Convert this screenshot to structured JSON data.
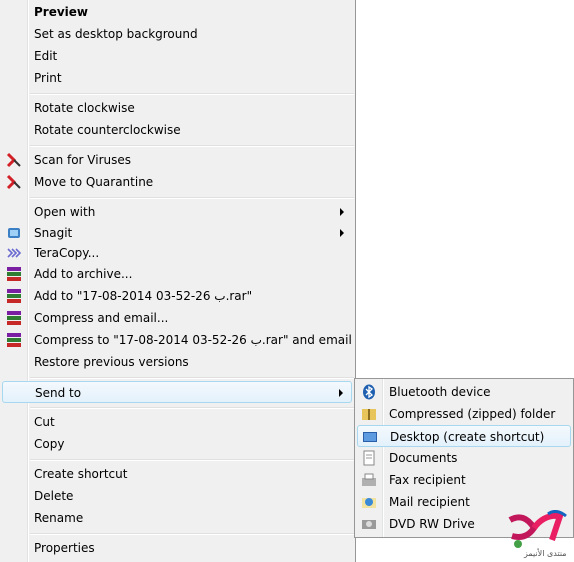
{
  "menu": {
    "preview": "Preview",
    "set_desktop_bg": "Set as desktop background",
    "edit": "Edit",
    "print": "Print",
    "rotate_cw": "Rotate clockwise",
    "rotate_ccw": "Rotate counterclockwise",
    "scan_viruses": "Scan for Viruses",
    "quarantine": "Move to Quarantine",
    "open_with": "Open with",
    "snagit": "Snagit",
    "teracopy": "TeraCopy...",
    "add_archive": "Add to archive...",
    "add_to_rar": "Add to \"17-08-2014 03-52-26 ب.rar\"",
    "compress_email": "Compress and email...",
    "compress_to_rar_email": "Compress to \"17-08-2014 03-52-26 ب.rar\" and email",
    "restore_prev": "Restore previous versions",
    "send_to": "Send to",
    "cut": "Cut",
    "copy": "Copy",
    "create_shortcut": "Create shortcut",
    "delete": "Delete",
    "rename": "Rename",
    "properties": "Properties"
  },
  "send_to_menu": {
    "bluetooth": "Bluetooth device",
    "compressed_folder": "Compressed (zipped) folder",
    "desktop_shortcut": "Desktop (create shortcut)",
    "documents": "Documents",
    "fax": "Fax recipient",
    "mail": "Mail recipient",
    "dvd": "DVD RW Drive"
  },
  "watermark": {
    "text": "منتدى الأنيمز"
  },
  "colors": {
    "hover_border": "#a8d8f0",
    "menu_bg": "#f0f0f0",
    "kaspersky_red": "#d32027"
  }
}
